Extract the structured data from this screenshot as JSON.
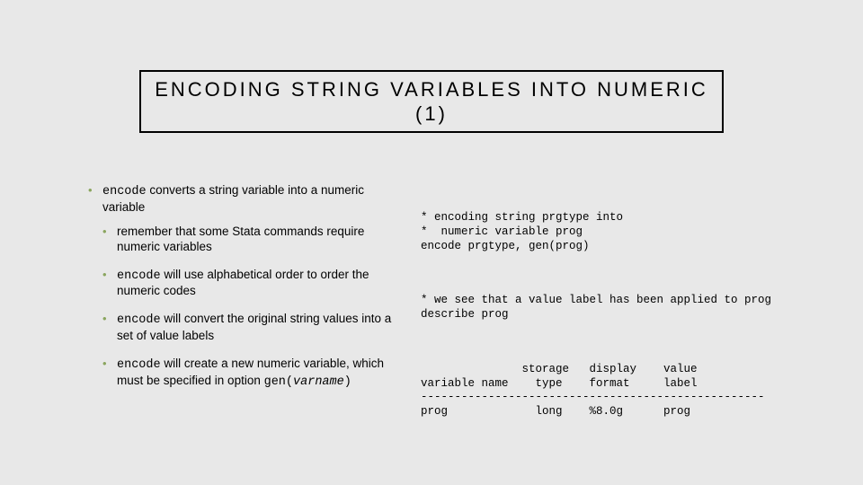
{
  "title": "ENCODING STRING VARIABLES INTO NUMERIC (1)",
  "left": {
    "main_prefix_code": "encode",
    "main_text": " converts a string variable into a numeric variable",
    "sub1": "remember that some Stata commands require numeric variables",
    "sub2_code": "encode",
    "sub2_text": " will use alphabetical order to order the numeric codes",
    "sub3_code": "encode",
    "sub3_text": " will convert the original string values into a set of value labels",
    "sub4_code": "encode",
    "sub4_text_a": " will create a new numeric variable, which must be specified in option ",
    "sub4_gen": "gen(",
    "sub4_var": "varname",
    "sub4_close": ")"
  },
  "code": {
    "block1": "* encoding string prgtype into\n*  numeric variable prog\nencode prgtype, gen(prog)",
    "block2": "* we see that a value label has been applied to prog\ndescribe prog",
    "block3": "               storage   display    value\nvariable name    type    format     label\n---------------------------------------------------\nprog             long    %8.0g      prog"
  },
  "chart_data": {
    "type": "table",
    "title": "describe prog output",
    "columns": [
      "variable name",
      "storage type",
      "display format",
      "value label"
    ],
    "rows": [
      [
        "prog",
        "long",
        "%8.0g",
        "prog"
      ]
    ]
  }
}
